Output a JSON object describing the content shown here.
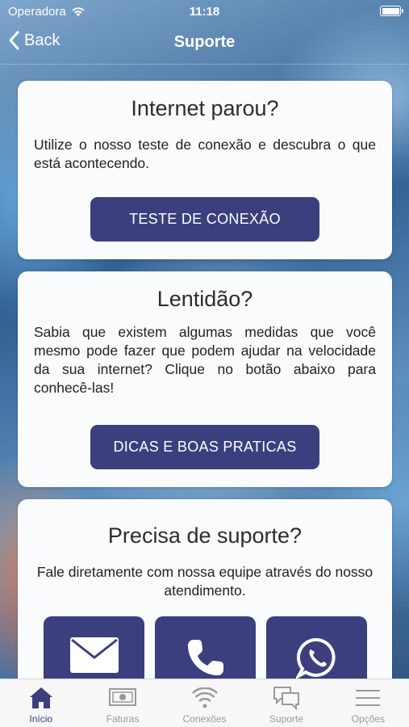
{
  "status_bar": {
    "carrier": "Operadora",
    "time": "11:18"
  },
  "nav": {
    "back_label": "Back",
    "title": "Suporte"
  },
  "cards": [
    {
      "title": "Internet parou?",
      "text": "Utilize o nosso teste de conexão e descubra o que está acontecendo.",
      "button": "TESTE DE CONEXÃO"
    },
    {
      "title": "Lentidão?",
      "text": "Sabia que existem algumas medidas que você mesmo pode fazer que podem ajudar na velocidade da sua internet? Clique no botão abaixo para conhecê-las!",
      "button": "DICAS E BOAS PRATICAS"
    },
    {
      "title": "Precisa de suporte?",
      "text": "Fale diretamente com nossa equipe através do nosso atendimento."
    }
  ],
  "contact_icons": [
    "envelope-icon",
    "phone-icon",
    "whatsapp-icon"
  ],
  "tabs": [
    {
      "label": "Início",
      "icon": "home-icon",
      "active": true
    },
    {
      "label": "Faturas",
      "icon": "bill-icon",
      "active": false
    },
    {
      "label": "Conexões",
      "icon": "wifi-icon",
      "active": false
    },
    {
      "label": "Suporte",
      "icon": "chat-icon",
      "active": false
    },
    {
      "label": "Opções",
      "icon": "menu-icon",
      "active": false
    }
  ],
  "colors": {
    "accent": "#3b3f7e",
    "tab_inactive": "#9a9a9a",
    "card_bg": "#fafbfc"
  }
}
